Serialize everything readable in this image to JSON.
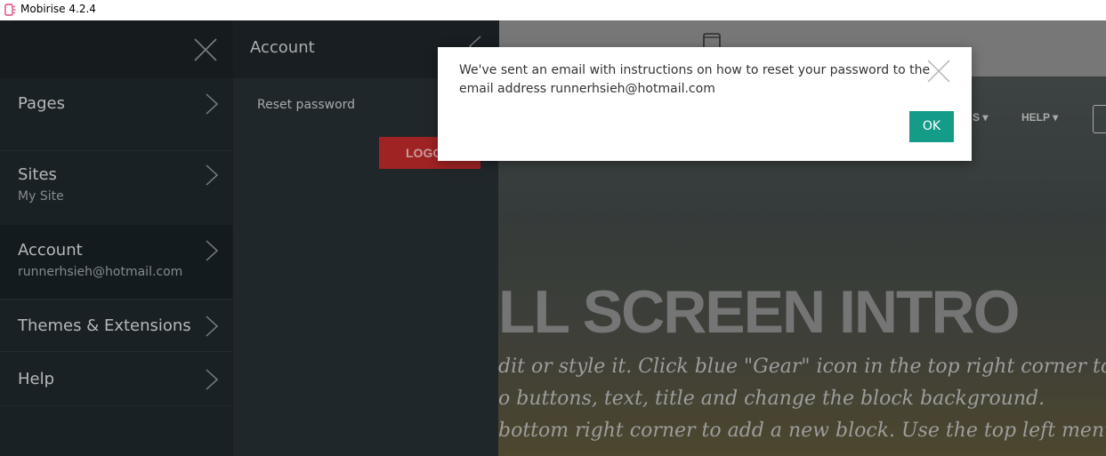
{
  "window": {
    "title": "Mobirise 4.2.4"
  },
  "sidebar": {
    "items": [
      {
        "label": "Pages",
        "sub": ""
      },
      {
        "label": "Sites",
        "sub": "My Site"
      },
      {
        "label": "Account",
        "sub": "runnerhsieh@hotmail.com"
      },
      {
        "label": "Themes & Extensions",
        "sub": ""
      },
      {
        "label": "Help",
        "sub": ""
      }
    ]
  },
  "account_panel": {
    "title": "Account",
    "reset_label": "Reset password",
    "logout_label": "LOGOUT"
  },
  "dialog": {
    "message": "We've sent an email with instructions on how to reset your password to the email address runnerhsieh@hotmail.com",
    "ok_label": "OK"
  },
  "preview": {
    "nav_partial": "S ▾",
    "nav_help": "HELP ▾",
    "intro_title": "LL SCREEN INTRO",
    "intro_lines": [
      "dit or style it. Click blue \"Gear\" icon in the top right corner to",
      "o buttons, text, title and change the block background.",
      "bottom right corner to add a new block. Use the top left menu to"
    ]
  },
  "colors": {
    "sidebar_bg": "#1f272b",
    "panel_bg": "#262e32",
    "ok_button": "#149c89",
    "logout_button": "#bb2a2a"
  }
}
